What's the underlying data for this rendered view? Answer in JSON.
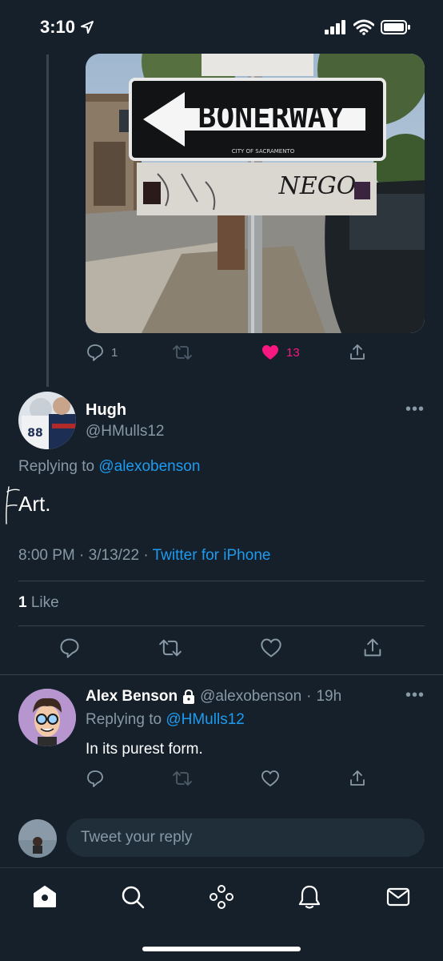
{
  "status_bar": {
    "time": "3:10"
  },
  "previous_tweet": {
    "image": {
      "sign_text": "BONERWAY",
      "sign_subtext": "CITY OF SACRAMENTO",
      "graffiti_text": "NEGO"
    },
    "actions": {
      "reply_count": "1",
      "like_count": "13"
    }
  },
  "colors": {
    "accent": "#1d9bf0",
    "like": "#f91880",
    "background": "#15202b",
    "muted": "#8899a6"
  },
  "main_tweet": {
    "author_name": "Hugh",
    "author_handle": "@HMulls12",
    "replying_to_label": "Replying to",
    "replying_to_handle": "@alexobenson",
    "text": "Art.",
    "time": "8:00 PM",
    "date": "3/13/22",
    "source": "Twitter for iPhone",
    "likes_count": "1",
    "likes_label": "Like"
  },
  "reply_tweet": {
    "author_name": "Alex Benson",
    "author_handle": "@alexobenson",
    "age": "19h",
    "replying_to_label": "Replying to",
    "replying_to_handle": "@HMulls12",
    "text": "In its purest form."
  },
  "composer": {
    "placeholder": "Tweet your reply"
  },
  "tab_bar": {
    "items": [
      "home-icon",
      "search-icon",
      "spaces-icon",
      "notifications-icon",
      "messages-icon"
    ]
  }
}
